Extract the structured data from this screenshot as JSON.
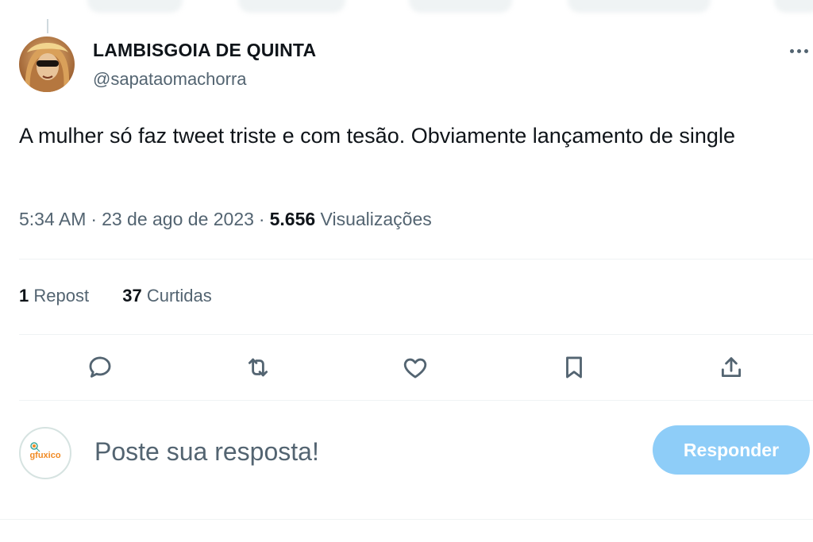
{
  "tweet": {
    "author": {
      "display_name": "LAMBISGOIA DE QUINTA",
      "handle": "@sapataomachorra",
      "avatar_icon": "profile-photo-sunglasses"
    },
    "text": "A mulher só faz tweet triste e com tesão. Obviamente lançamento de single",
    "time": "5:34 AM",
    "date": "23 de ago de 2023",
    "views_count": "5.656",
    "views_label": "Visualizações",
    "separator": "·"
  },
  "stats": {
    "reposts_count": "1",
    "reposts_label": "Repost",
    "likes_count": "37",
    "likes_label": "Curtidas"
  },
  "actions": [
    {
      "name": "reply",
      "icon": "reply-bubble-icon"
    },
    {
      "name": "repost",
      "icon": "repost-arrows-icon"
    },
    {
      "name": "like",
      "icon": "heart-icon"
    },
    {
      "name": "bookmark",
      "icon": "bookmark-icon"
    },
    {
      "name": "share",
      "icon": "share-upload-icon"
    }
  ],
  "composer": {
    "avatar_text": "gfuxico",
    "placeholder": "Poste sua resposta!",
    "reply_button_label": "Responder"
  },
  "colors": {
    "text_primary": "#0f1419",
    "text_secondary": "#536471",
    "divider": "#eff3f4",
    "reply_button_disabled": "#8ecdf8",
    "gfuxico_orange": "#f08a24",
    "gfuxico_teal": "#3aa79a"
  }
}
